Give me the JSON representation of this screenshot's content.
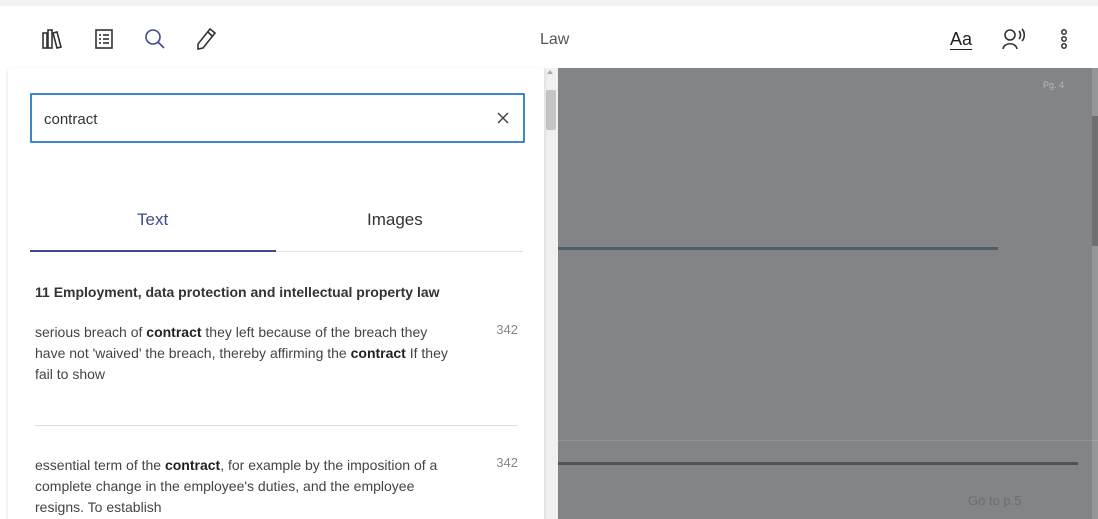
{
  "toolbar": {
    "title": "Law",
    "font_label": "Aa",
    "icons": [
      "library-icon",
      "contents-icon",
      "search-icon",
      "pencil-icon",
      "read-aloud-icon",
      "more-icon"
    ]
  },
  "search": {
    "value": "contract",
    "placeholder": ""
  },
  "tabs": [
    {
      "label": "Text",
      "active": true
    },
    {
      "label": "Images",
      "active": false
    }
  ],
  "results": {
    "chapter": "11 Employment, data protection and intellectual property law",
    "items": [
      {
        "segments": [
          {
            "text": "serious breach of ",
            "bold": false
          },
          {
            "text": "contract",
            "bold": true
          },
          {
            "text": " they left because of the breach they have not 'waived' the breach, thereby affirming the ",
            "bold": false
          },
          {
            "text": "contract",
            "bold": true
          },
          {
            "text": " If they fail to show",
            "bold": false
          }
        ],
        "page": "342"
      },
      {
        "segments": [
          {
            "text": "essential term of the ",
            "bold": false
          },
          {
            "text": "contract",
            "bold": true
          },
          {
            "text": ", for example by the imposition of a complete change in the employee's duties, and the employee resigns. To establish",
            "bold": false
          }
        ],
        "page": "342"
      }
    ]
  },
  "reader": {
    "page_label": "Pg. 4",
    "goto_label": "Go to p.5"
  },
  "colors": {
    "accent": "#3f4a8a",
    "search_border": "#3d87c8",
    "overlay": "#808185"
  }
}
